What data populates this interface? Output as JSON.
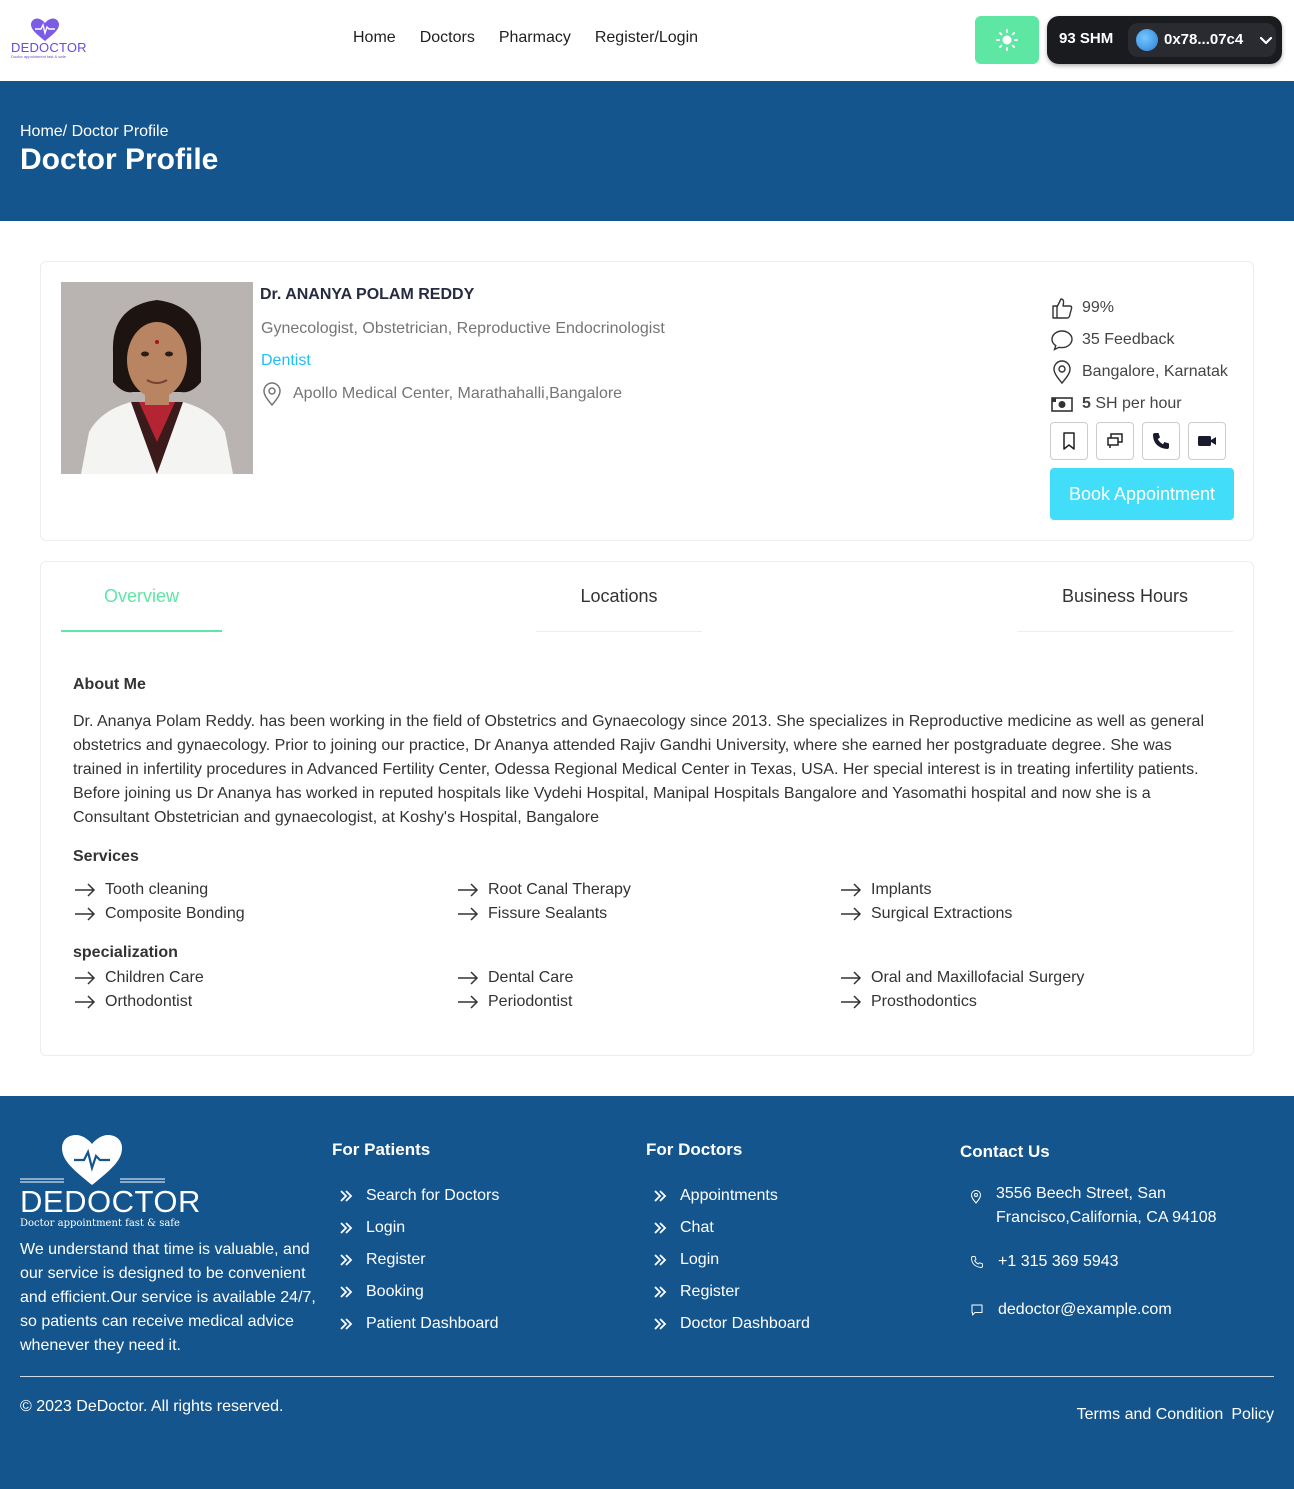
{
  "header": {
    "logo_text": "DEDOCTOR",
    "logo_tagline": "Doctor appointment fast & safe",
    "nav": [
      "Home",
      "Doctors",
      "Pharmacy",
      "Register/Login"
    ],
    "wallet_balance": "93 SHM",
    "wallet_address": "0x78...07c4"
  },
  "banner": {
    "breadcrumb": "Home/ Doctor Profile",
    "title": "Doctor Profile"
  },
  "doctor": {
    "name": "Dr. ANANYA POLAM REDDY",
    "specialties": "Gynecologist, Obstetrician, Reproductive Endocrinologist",
    "department": "Dentist",
    "clinic": "Apollo Medical Center, Marathahalli,Bangalore",
    "rating": "99%",
    "feedback": "35 Feedback",
    "location": "Bangalore, Karnatak",
    "price_amount": "5",
    "price_unit": "SH per hour",
    "book_label": "Book Appointment"
  },
  "tabs": [
    "Overview",
    "Locations",
    "Business Hours"
  ],
  "overview": {
    "about_title": "About Me",
    "about_text": "Dr. Ananya Polam Reddy. has been working in the field of Obstetrics and Gynaecology since 2013. She specializes in Reproductive medicine as well as general obstetrics and gynaecology. Prior to joining our practice, Dr Ananya attended Rajiv Gandhi University, where she earned her postgraduate degree. She was trained in infertility procedures in Advanced Fertility Center, Odessa Regional Medical Center in Texas, USA. Her special interest is in treating infertility patients. Before joining us Dr Ananya has worked in reputed hospitals like Vydehi Hospital, Manipal Hospitals Bangalore and Yasomathi hospital and now she is a Consultant Obstetrician and gynaecologist, at Koshy's Hospital, Bangalore",
    "services_title": "Services",
    "services": [
      "Tooth cleaning",
      "Root Canal Therapy",
      "Implants",
      "Composite Bonding",
      "Fissure Sealants",
      "Surgical Extractions"
    ],
    "specialization_title": "specialization",
    "specializations": [
      "Children Care",
      "Dental Care",
      "Oral and Maxillofacial Surgery",
      "Orthodontist",
      "Periodontist",
      "Prosthodontics"
    ]
  },
  "footer": {
    "logo_text": "DEDOCTOR",
    "logo_tagline": "Doctor appointment fast & safe",
    "description": "We understand that time is valuable, and our service is designed to be convenient and efficient.Our service is available 24/7, so patients can receive medical advice whenever they need it.",
    "patients_title": "For Patients",
    "patients_links": [
      "Search for Doctors",
      "Login",
      "Register",
      "Booking",
      "Patient Dashboard"
    ],
    "doctors_title": "For Doctors",
    "doctors_links": [
      "Appointments",
      "Chat",
      "Login",
      "Register",
      "Doctor Dashboard"
    ],
    "contact_title": "Contact Us",
    "address": "3556 Beech Street, San Francisco,California, CA 94108",
    "phone": "+1 315 369 5943",
    "email": "dedoctor@example.com",
    "copyright": "© 2023 DeDoctor. All rights reserved.",
    "terms": "Terms and Condition",
    "policy": "Policy"
  },
  "colors": {
    "primary_blue": "#15558d",
    "accent_green": "#5ee6a3",
    "accent_cyan": "#42ddf9",
    "logo_purple": "#6b4bd8"
  }
}
